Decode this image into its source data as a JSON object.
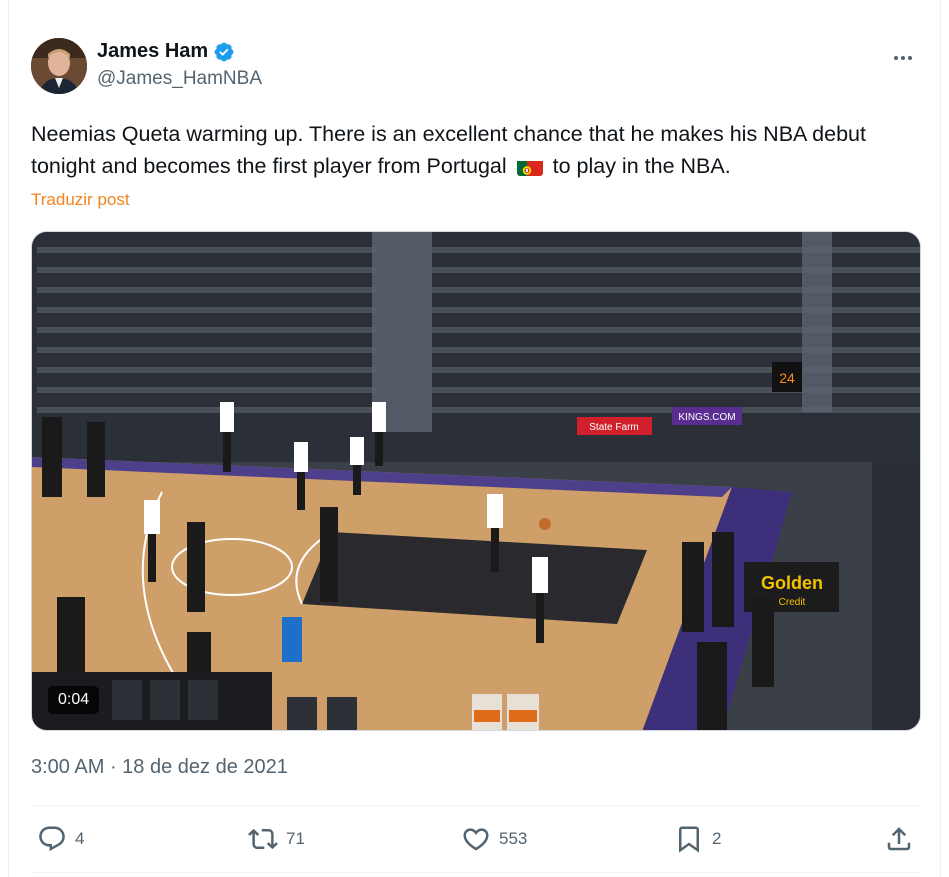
{
  "author": {
    "display_name": "James Ham",
    "handle": "@James_HamNBA"
  },
  "post": {
    "text_before_flag": "Neemias Queta warming up. There is an excellent chance that he makes his NBA debut tonight and becomes the first player from Portugal",
    "flag_icon": "portugal-flag-emoji",
    "text_after_flag": "to play in the NBA.",
    "translate_label": "Traduzir post"
  },
  "media": {
    "type": "video",
    "duration": "0:04",
    "scene_signs": {
      "state_farm": "State Farm",
      "kings_com": "KINGS.COM",
      "golden": "Golden",
      "credit": "Credit",
      "shot_clock": "24"
    }
  },
  "timestamp": {
    "time": "3:00 AM",
    "separator": " · ",
    "date": "18 de dez de 2021"
  },
  "actions": {
    "replies": "4",
    "reposts": "71",
    "likes": "553",
    "bookmarks": "2"
  },
  "colors": {
    "text": "#0f1419",
    "secondary": "#536471",
    "translate": "#f4821f",
    "verified": "#1d9bf0",
    "border": "#eff3f4"
  }
}
